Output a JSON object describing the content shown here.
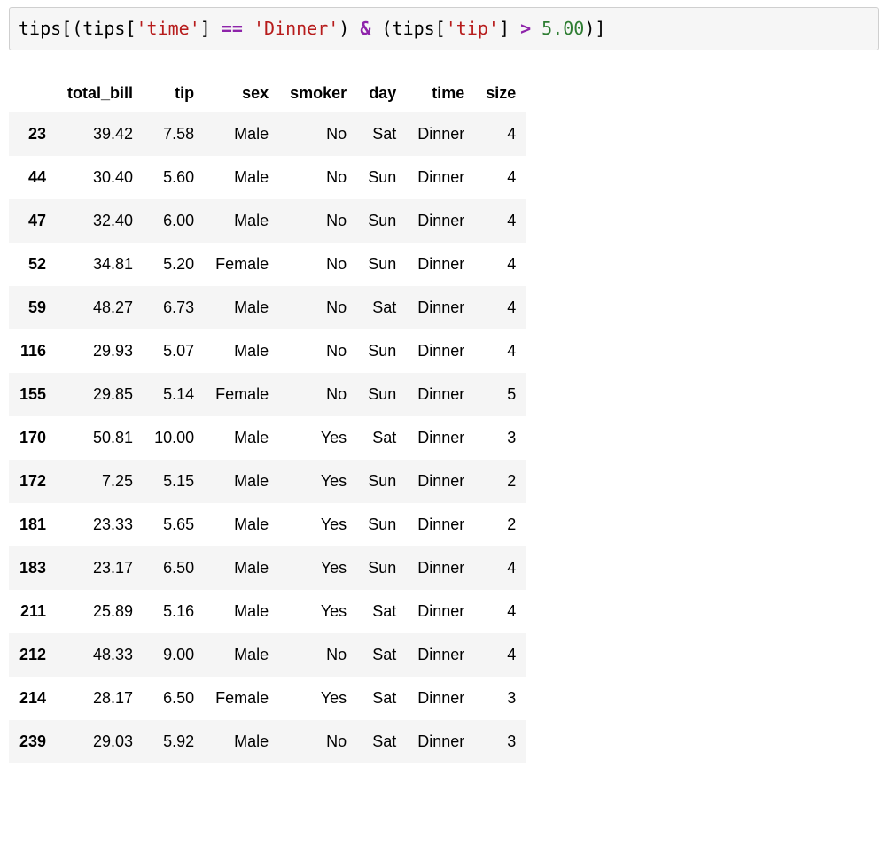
{
  "code": {
    "seg1": "tips",
    "seg2": "[(",
    "seg3": "tips",
    "seg4": "[",
    "seg5": "'time'",
    "seg6": "]",
    "seg7": " ",
    "seg8": "==",
    "seg9": " ",
    "seg10": "'Dinner'",
    "seg11": ")",
    "seg12": " ",
    "seg13": "&",
    "seg14": " (",
    "seg15": "tips",
    "seg16": "[",
    "seg17": "'tip'",
    "seg18": "]",
    "seg19": " ",
    "seg20": ">",
    "seg21": " ",
    "seg22": "5.00",
    "seg23": ")]"
  },
  "table": {
    "columns": [
      "total_bill",
      "tip",
      "sex",
      "smoker",
      "day",
      "time",
      "size"
    ],
    "rows": [
      {
        "idx": "23",
        "total_bill": "39.42",
        "tip": "7.58",
        "sex": "Male",
        "smoker": "No",
        "day": "Sat",
        "time": "Dinner",
        "size": "4"
      },
      {
        "idx": "44",
        "total_bill": "30.40",
        "tip": "5.60",
        "sex": "Male",
        "smoker": "No",
        "day": "Sun",
        "time": "Dinner",
        "size": "4"
      },
      {
        "idx": "47",
        "total_bill": "32.40",
        "tip": "6.00",
        "sex": "Male",
        "smoker": "No",
        "day": "Sun",
        "time": "Dinner",
        "size": "4"
      },
      {
        "idx": "52",
        "total_bill": "34.81",
        "tip": "5.20",
        "sex": "Female",
        "smoker": "No",
        "day": "Sun",
        "time": "Dinner",
        "size": "4"
      },
      {
        "idx": "59",
        "total_bill": "48.27",
        "tip": "6.73",
        "sex": "Male",
        "smoker": "No",
        "day": "Sat",
        "time": "Dinner",
        "size": "4"
      },
      {
        "idx": "116",
        "total_bill": "29.93",
        "tip": "5.07",
        "sex": "Male",
        "smoker": "No",
        "day": "Sun",
        "time": "Dinner",
        "size": "4"
      },
      {
        "idx": "155",
        "total_bill": "29.85",
        "tip": "5.14",
        "sex": "Female",
        "smoker": "No",
        "day": "Sun",
        "time": "Dinner",
        "size": "5"
      },
      {
        "idx": "170",
        "total_bill": "50.81",
        "tip": "10.00",
        "sex": "Male",
        "smoker": "Yes",
        "day": "Sat",
        "time": "Dinner",
        "size": "3"
      },
      {
        "idx": "172",
        "total_bill": "7.25",
        "tip": "5.15",
        "sex": "Male",
        "smoker": "Yes",
        "day": "Sun",
        "time": "Dinner",
        "size": "2"
      },
      {
        "idx": "181",
        "total_bill": "23.33",
        "tip": "5.65",
        "sex": "Male",
        "smoker": "Yes",
        "day": "Sun",
        "time": "Dinner",
        "size": "2"
      },
      {
        "idx": "183",
        "total_bill": "23.17",
        "tip": "6.50",
        "sex": "Male",
        "smoker": "Yes",
        "day": "Sun",
        "time": "Dinner",
        "size": "4"
      },
      {
        "idx": "211",
        "total_bill": "25.89",
        "tip": "5.16",
        "sex": "Male",
        "smoker": "Yes",
        "day": "Sat",
        "time": "Dinner",
        "size": "4"
      },
      {
        "idx": "212",
        "total_bill": "48.33",
        "tip": "9.00",
        "sex": "Male",
        "smoker": "No",
        "day": "Sat",
        "time": "Dinner",
        "size": "4"
      },
      {
        "idx": "214",
        "total_bill": "28.17",
        "tip": "6.50",
        "sex": "Female",
        "smoker": "Yes",
        "day": "Sat",
        "time": "Dinner",
        "size": "3"
      },
      {
        "idx": "239",
        "total_bill": "29.03",
        "tip": "5.92",
        "sex": "Male",
        "smoker": "No",
        "day": "Sat",
        "time": "Dinner",
        "size": "3"
      }
    ]
  }
}
